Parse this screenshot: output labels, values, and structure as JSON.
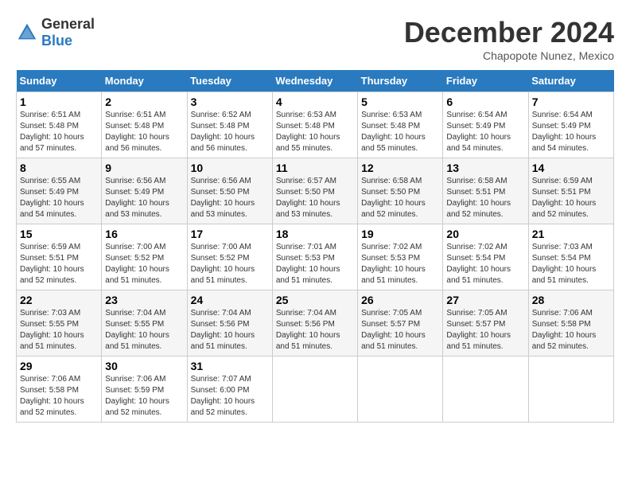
{
  "header": {
    "logo_general": "General",
    "logo_blue": "Blue",
    "title": "December 2024",
    "subtitle": "Chapopote Nunez, Mexico"
  },
  "weekdays": [
    "Sunday",
    "Monday",
    "Tuesday",
    "Wednesday",
    "Thursday",
    "Friday",
    "Saturday"
  ],
  "weeks": [
    [
      {
        "day": "1",
        "sunrise": "6:51 AM",
        "sunset": "5:48 PM",
        "daylight": "10 hours and 57 minutes."
      },
      {
        "day": "2",
        "sunrise": "6:51 AM",
        "sunset": "5:48 PM",
        "daylight": "10 hours and 56 minutes."
      },
      {
        "day": "3",
        "sunrise": "6:52 AM",
        "sunset": "5:48 PM",
        "daylight": "10 hours and 56 minutes."
      },
      {
        "day": "4",
        "sunrise": "6:53 AM",
        "sunset": "5:48 PM",
        "daylight": "10 hours and 55 minutes."
      },
      {
        "day": "5",
        "sunrise": "6:53 AM",
        "sunset": "5:48 PM",
        "daylight": "10 hours and 55 minutes."
      },
      {
        "day": "6",
        "sunrise": "6:54 AM",
        "sunset": "5:49 PM",
        "daylight": "10 hours and 54 minutes."
      },
      {
        "day": "7",
        "sunrise": "6:54 AM",
        "sunset": "5:49 PM",
        "daylight": "10 hours and 54 minutes."
      }
    ],
    [
      {
        "day": "8",
        "sunrise": "6:55 AM",
        "sunset": "5:49 PM",
        "daylight": "10 hours and 54 minutes."
      },
      {
        "day": "9",
        "sunrise": "6:56 AM",
        "sunset": "5:49 PM",
        "daylight": "10 hours and 53 minutes."
      },
      {
        "day": "10",
        "sunrise": "6:56 AM",
        "sunset": "5:50 PM",
        "daylight": "10 hours and 53 minutes."
      },
      {
        "day": "11",
        "sunrise": "6:57 AM",
        "sunset": "5:50 PM",
        "daylight": "10 hours and 53 minutes."
      },
      {
        "day": "12",
        "sunrise": "6:58 AM",
        "sunset": "5:50 PM",
        "daylight": "10 hours and 52 minutes."
      },
      {
        "day": "13",
        "sunrise": "6:58 AM",
        "sunset": "5:51 PM",
        "daylight": "10 hours and 52 minutes."
      },
      {
        "day": "14",
        "sunrise": "6:59 AM",
        "sunset": "5:51 PM",
        "daylight": "10 hours and 52 minutes."
      }
    ],
    [
      {
        "day": "15",
        "sunrise": "6:59 AM",
        "sunset": "5:51 PM",
        "daylight": "10 hours and 52 minutes."
      },
      {
        "day": "16",
        "sunrise": "7:00 AM",
        "sunset": "5:52 PM",
        "daylight": "10 hours and 51 minutes."
      },
      {
        "day": "17",
        "sunrise": "7:00 AM",
        "sunset": "5:52 PM",
        "daylight": "10 hours and 51 minutes."
      },
      {
        "day": "18",
        "sunrise": "7:01 AM",
        "sunset": "5:53 PM",
        "daylight": "10 hours and 51 minutes."
      },
      {
        "day": "19",
        "sunrise": "7:02 AM",
        "sunset": "5:53 PM",
        "daylight": "10 hours and 51 minutes."
      },
      {
        "day": "20",
        "sunrise": "7:02 AM",
        "sunset": "5:54 PM",
        "daylight": "10 hours and 51 minutes."
      },
      {
        "day": "21",
        "sunrise": "7:03 AM",
        "sunset": "5:54 PM",
        "daylight": "10 hours and 51 minutes."
      }
    ],
    [
      {
        "day": "22",
        "sunrise": "7:03 AM",
        "sunset": "5:55 PM",
        "daylight": "10 hours and 51 minutes."
      },
      {
        "day": "23",
        "sunrise": "7:04 AM",
        "sunset": "5:55 PM",
        "daylight": "10 hours and 51 minutes."
      },
      {
        "day": "24",
        "sunrise": "7:04 AM",
        "sunset": "5:56 PM",
        "daylight": "10 hours and 51 minutes."
      },
      {
        "day": "25",
        "sunrise": "7:04 AM",
        "sunset": "5:56 PM",
        "daylight": "10 hours and 51 minutes."
      },
      {
        "day": "26",
        "sunrise": "7:05 AM",
        "sunset": "5:57 PM",
        "daylight": "10 hours and 51 minutes."
      },
      {
        "day": "27",
        "sunrise": "7:05 AM",
        "sunset": "5:57 PM",
        "daylight": "10 hours and 51 minutes."
      },
      {
        "day": "28",
        "sunrise": "7:06 AM",
        "sunset": "5:58 PM",
        "daylight": "10 hours and 52 minutes."
      }
    ],
    [
      {
        "day": "29",
        "sunrise": "7:06 AM",
        "sunset": "5:58 PM",
        "daylight": "10 hours and 52 minutes."
      },
      {
        "day": "30",
        "sunrise": "7:06 AM",
        "sunset": "5:59 PM",
        "daylight": "10 hours and 52 minutes."
      },
      {
        "day": "31",
        "sunrise": "7:07 AM",
        "sunset": "6:00 PM",
        "daylight": "10 hours and 52 minutes."
      },
      null,
      null,
      null,
      null
    ]
  ]
}
